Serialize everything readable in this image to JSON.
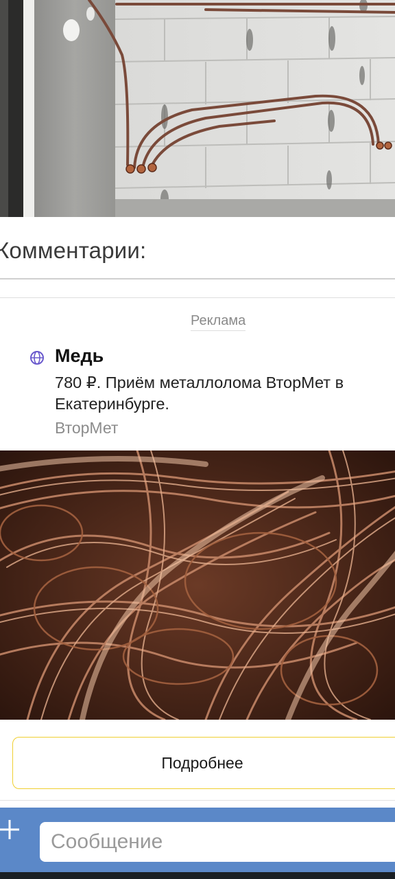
{
  "comments": {
    "title": "Комментарии:"
  },
  "ad": {
    "label": "Реклама",
    "title": "Медь",
    "text": "780 ₽. Приём металлолома ВторМет в Екатеринбурге.",
    "source": "ВторМет",
    "button_label": "Подробнее",
    "icon": "globe-icon"
  },
  "composer": {
    "placeholder": "Сообщение",
    "attach_icon": "plus-icon"
  },
  "colors": {
    "composer_bg": "#5b88c8",
    "button_border": "#f0cf30",
    "globe_icon": "#6a5acd"
  }
}
